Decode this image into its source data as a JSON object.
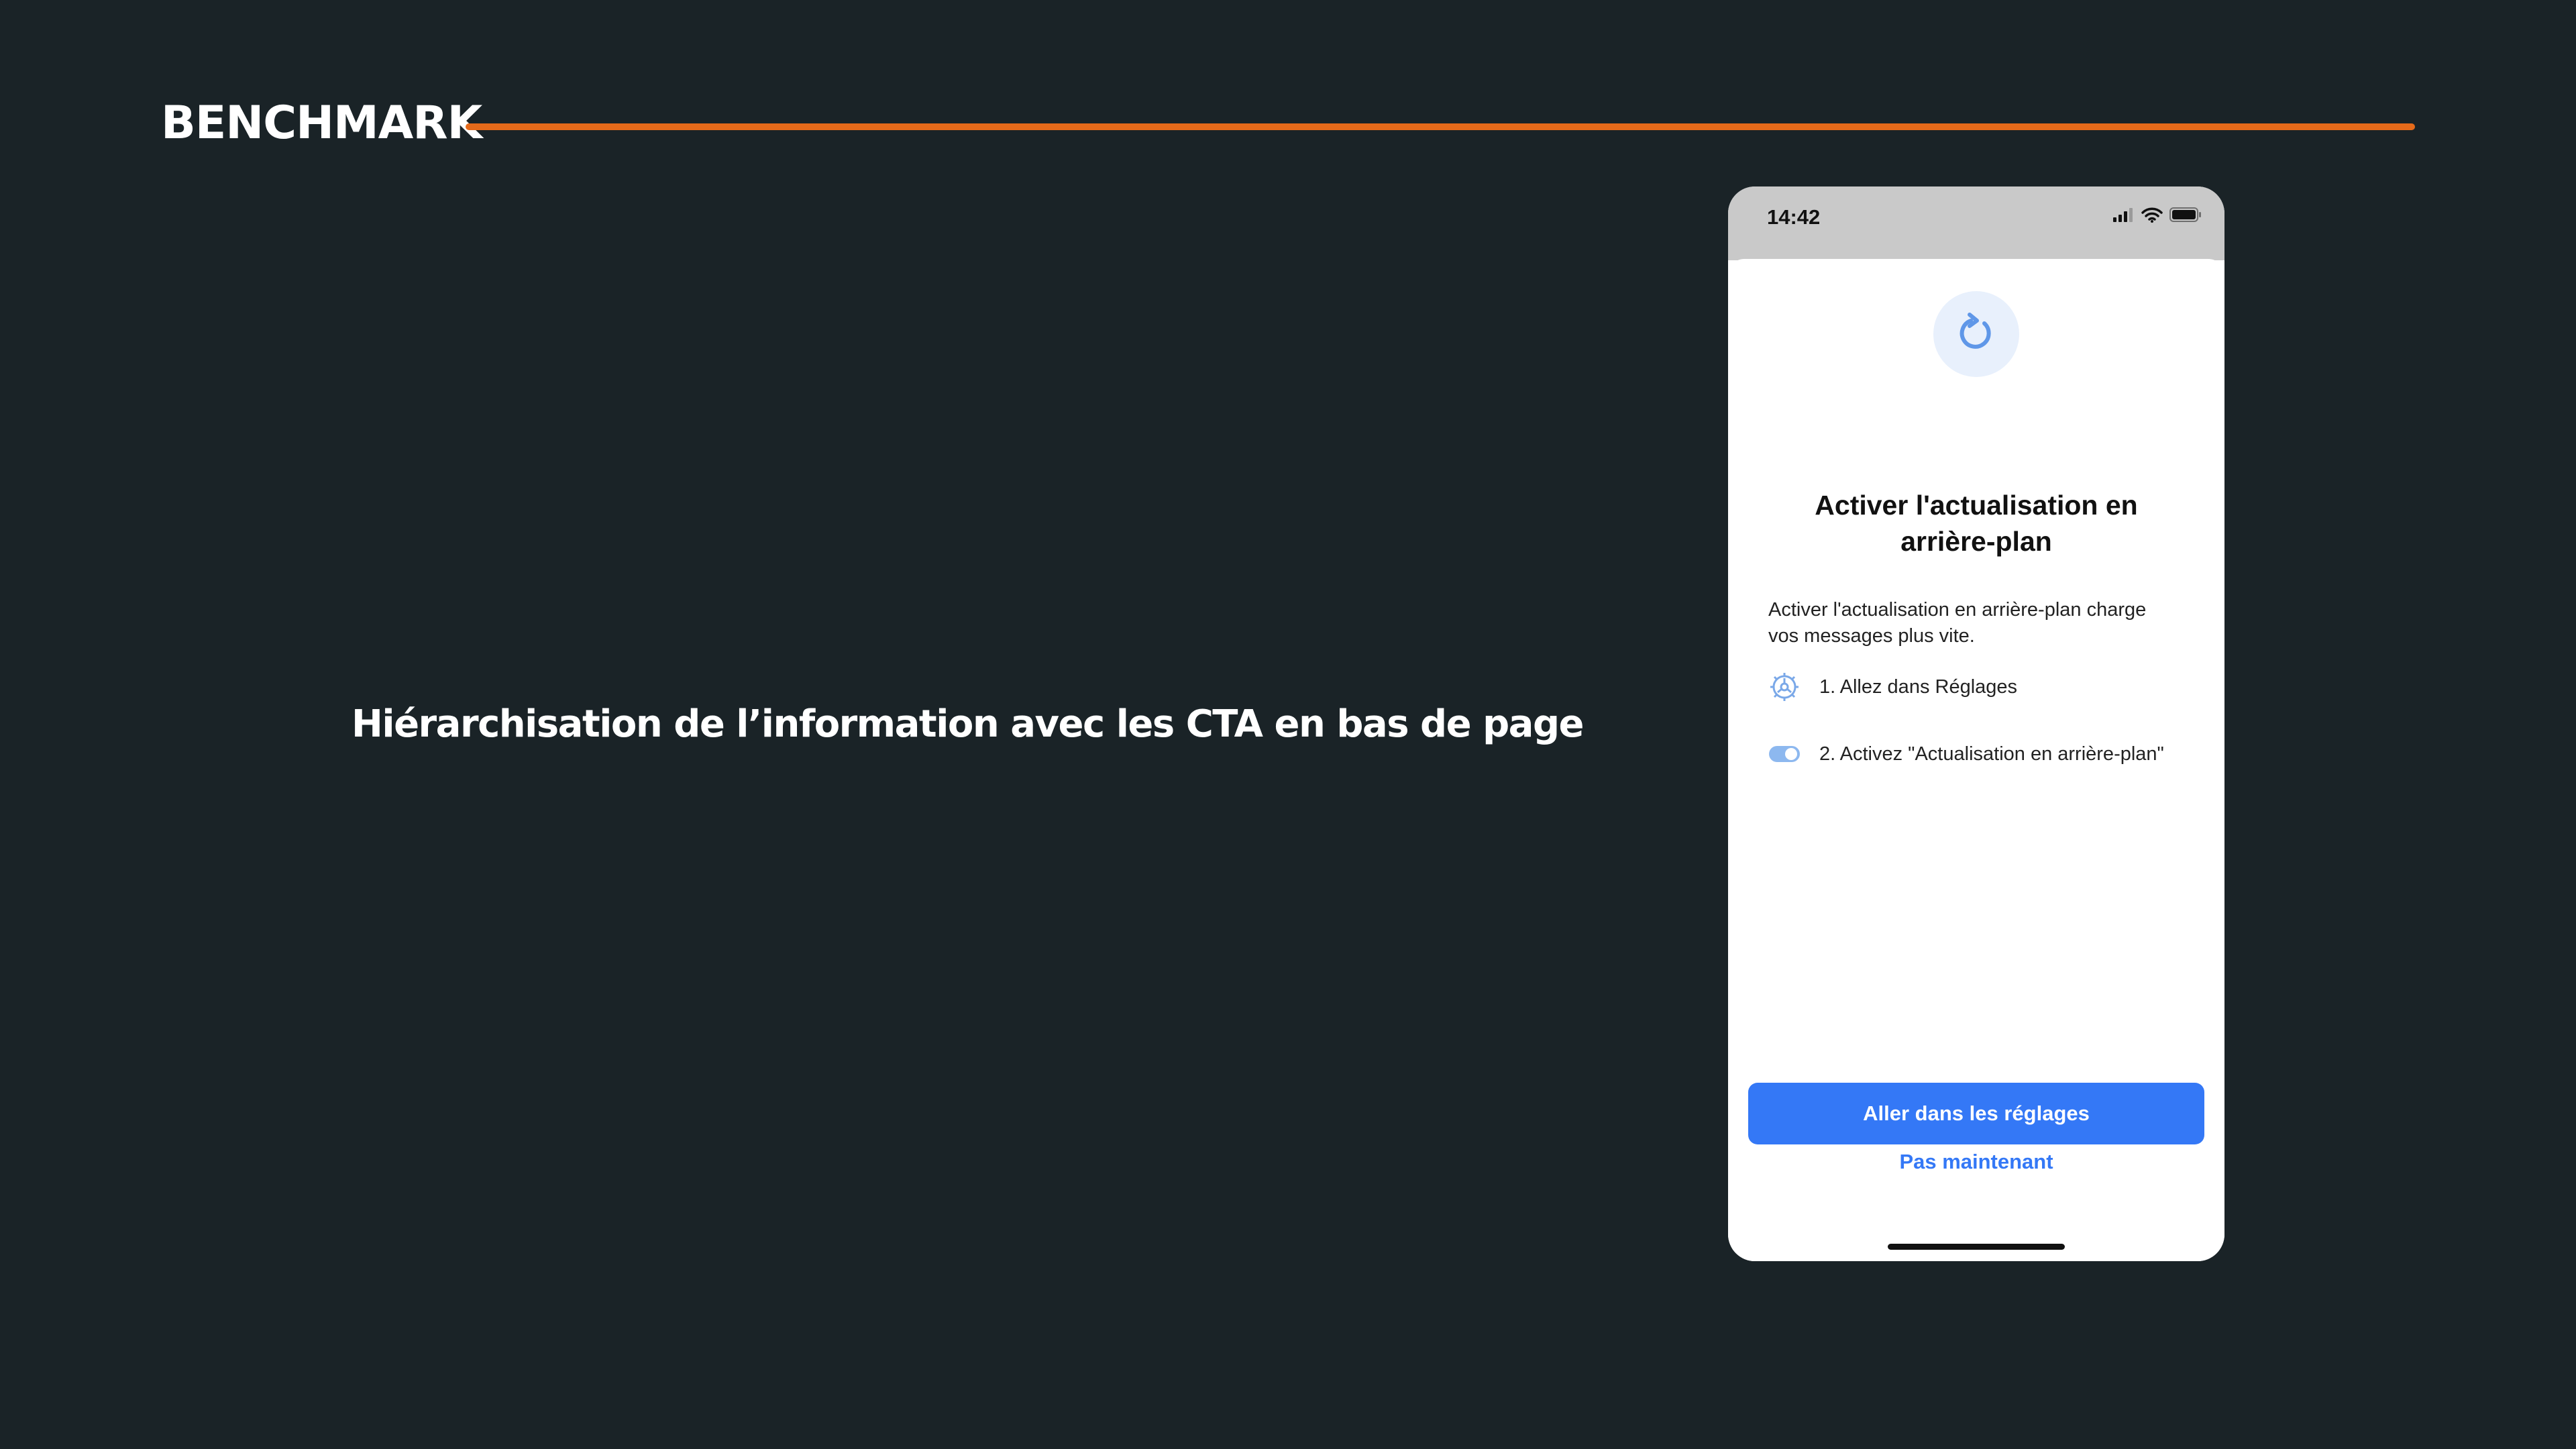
{
  "slide": {
    "title": "BENCHMARK",
    "caption": "Hiérarchisation de l’information avec les CTA en bas de page",
    "accent_color": "#e56a1a",
    "background_color": "#1a2327"
  },
  "phone": {
    "status_bar": {
      "time": "14:42",
      "icons": [
        "signal-icon",
        "wifi-icon",
        "battery-icon"
      ]
    },
    "modal": {
      "icon": "refresh-icon",
      "title": "Activer l'actualisation en\narrière-plan",
      "body": "Activer l'actualisation en arrière-plan charge\nvos messages plus vite.",
      "steps": [
        {
          "icon": "gear-icon",
          "label": "1. Allez dans Réglages"
        },
        {
          "icon": "toggle-icon",
          "label": "2. Activez \"Actualisation en arrière-plan\""
        }
      ],
      "primary_button": "Aller dans les réglages",
      "secondary_button": "Pas maintenant",
      "accent_color": "#3478f6"
    }
  }
}
